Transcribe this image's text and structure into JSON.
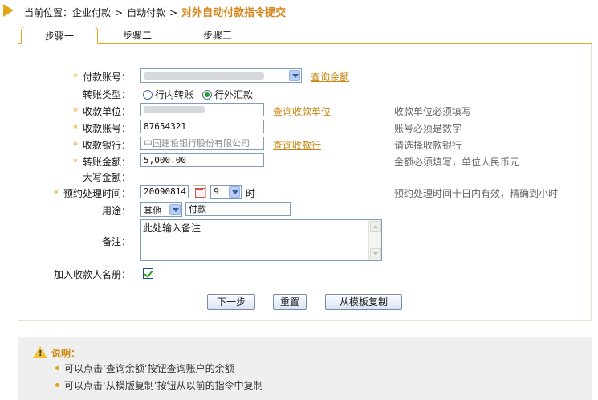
{
  "breadcrumb": {
    "prefix": "当前位置：",
    "items": [
      "企业付款",
      "自动付款"
    ],
    "separator": ">",
    "current": "对外自动付款指令提交"
  },
  "tabs": [
    {
      "label": "步骤一",
      "active": true
    },
    {
      "label": "步骤二",
      "active": false
    },
    {
      "label": "步骤三",
      "active": false
    }
  ],
  "form": {
    "payer_account": {
      "label": "付款账号：",
      "required": true,
      "link": "查询余额"
    },
    "transfer_type": {
      "label": "转账类型：",
      "options": [
        "行内转账",
        "行外汇款"
      ],
      "selected": "行外汇款"
    },
    "payee_name": {
      "label": "收款单位：",
      "required": true,
      "link": "查询收款单位",
      "hint": "收款单位必须填写"
    },
    "payee_account": {
      "label": "收款账号：",
      "required": true,
      "value": "87654321",
      "hint": "账号必须是数字"
    },
    "payee_bank": {
      "label": "收款银行：",
      "required": true,
      "value": "中国建设银行股份有限公司",
      "link": "查询收款行",
      "hint": "请选择收款银行"
    },
    "amount": {
      "label": "转账金额：",
      "required": true,
      "value": "5,000.00",
      "hint": "金额必须填写，单位人民币元"
    },
    "amount_upper": {
      "label": "大写金额："
    },
    "schedule": {
      "label": "预约处理时间：",
      "required": true,
      "date": "20090814",
      "hour": "9",
      "unit": "时",
      "hint": "预约处理时间十日内有效，精确到小时"
    },
    "purpose": {
      "label": "用途：",
      "select": "其他",
      "value": "付款"
    },
    "remark": {
      "label": "备注：",
      "value": "此处输入备注"
    },
    "add_payee": {
      "label": "加入收款人名册：",
      "checked": true
    }
  },
  "buttons": {
    "next": "下一步",
    "reset": "重置",
    "copy": "从模板复制"
  },
  "notes": {
    "title": "说明：",
    "items": [
      "可以点击‘查询余额’按钮查询账户的余额",
      "可以点击‘从模版复制’按钮从以前的指令中复制"
    ]
  },
  "colors": {
    "accent": "#e2a51d",
    "link": "#c7860f",
    "border": "#7f9db9"
  }
}
